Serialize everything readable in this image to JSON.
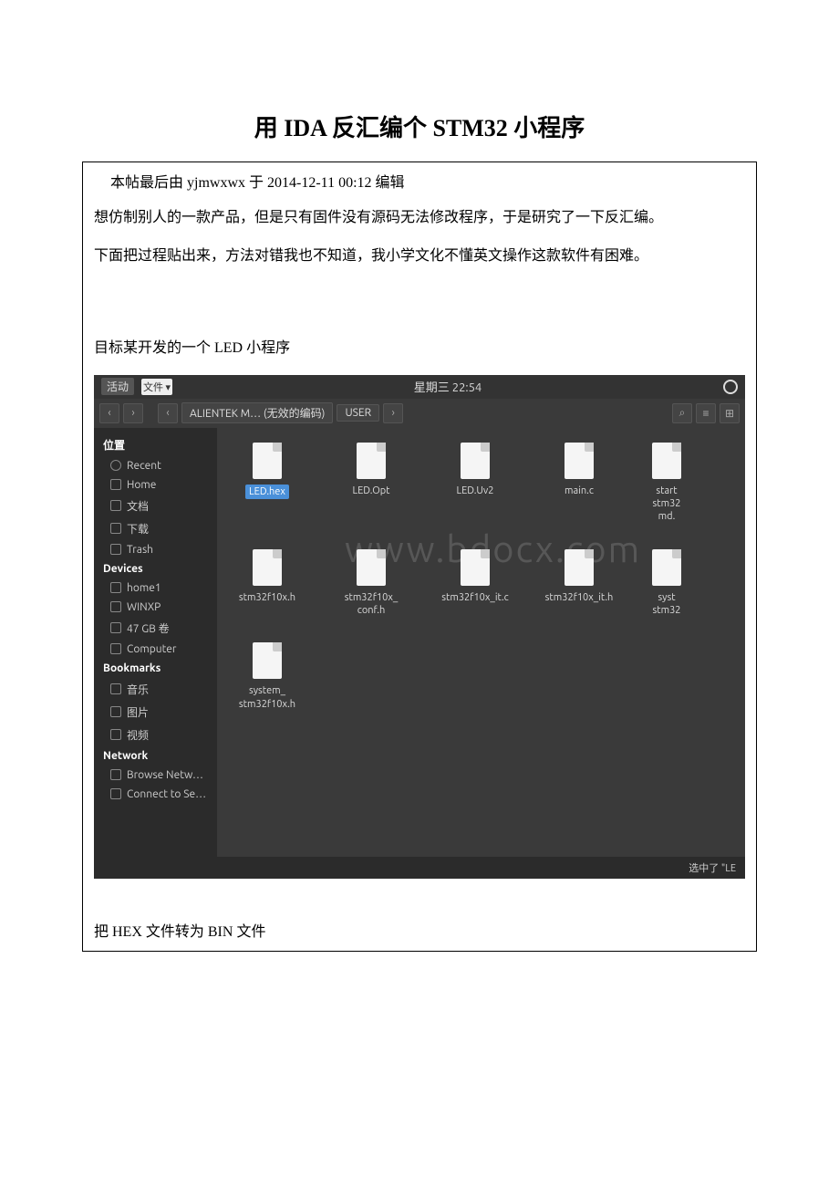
{
  "title": "用 IDA 反汇编个 STM32 小程序",
  "post_meta": "本帖最后由 yjmwxwx 于 2014-12-11 00:12 编辑",
  "para1": "想仿制别人的一款产品，但是只有固件没有源码无法修改程序，于是研究了一下反汇编。",
  "para2": "下面把过程贴出来，方法对错我也不知道，我小学文化不懂英文操作这款软件有困难。",
  "para3": "目标某开发的一个 LED 小程序",
  "para4": "把 HEX 文件转为 BIN 文件",
  "fm": {
    "top": {
      "activities": "活动",
      "files": "文件 ▾",
      "clock": "星期三 22:54"
    },
    "toolbar": {
      "back": "‹",
      "forward": "›",
      "back2": "‹",
      "crumb1": "ALIENTEK M… (无效的编码)",
      "crumb2": "USER",
      "next": "›"
    },
    "sidebar": {
      "places_header": "位置",
      "places": [
        {
          "icon": "recent",
          "label": "Recent"
        },
        {
          "icon": "home",
          "label": "Home"
        },
        {
          "icon": "docs",
          "label": "文档"
        },
        {
          "icon": "download",
          "label": "下载"
        },
        {
          "icon": "trash",
          "label": "Trash"
        }
      ],
      "devices_header": "Devices",
      "devices": [
        {
          "icon": "disk",
          "label": "home1"
        },
        {
          "icon": "disk",
          "label": "WINXP"
        },
        {
          "icon": "disk",
          "label": "47 GB 卷"
        },
        {
          "icon": "disk",
          "label": "Computer"
        }
      ],
      "bookmarks_header": "Bookmarks",
      "bookmarks": [
        {
          "icon": "folder",
          "label": "音乐"
        },
        {
          "icon": "folder",
          "label": "图片"
        },
        {
          "icon": "folder",
          "label": "视频"
        }
      ],
      "network_header": "Network",
      "network": [
        {
          "icon": "net",
          "label": "Browse Netw…"
        },
        {
          "icon": "net",
          "label": "Connect to Se…"
        }
      ]
    },
    "files": [
      {
        "name": "LED.hex",
        "selected": true
      },
      {
        "name": "LED.Opt"
      },
      {
        "name": "LED.Uv2"
      },
      {
        "name": "main.c"
      },
      {
        "name": "start\nstm32\nmd."
      },
      {
        "name": "stm32f10x.h"
      },
      {
        "name": "stm32f10x_\nconf.h"
      },
      {
        "name": "stm32f10x_it.c"
      },
      {
        "name": "stm32f10x_it.h"
      },
      {
        "name": "syst\nstm32"
      },
      {
        "name": "system_\nstm32f10x.h"
      }
    ],
    "watermark": "www.bdocx.com",
    "status": "选中了 \"LE"
  }
}
